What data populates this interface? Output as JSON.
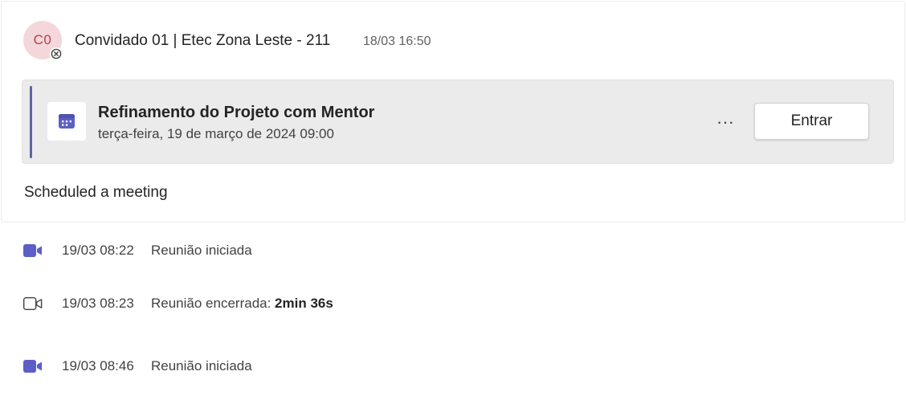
{
  "post": {
    "avatar_initials": "C0",
    "sender": "Convidado 01 | Etec Zona Leste - 211",
    "timestamp": "18/03 16:50",
    "presence_icon": "blocked-circle-icon",
    "meeting_card": {
      "icon": "calendar-icon",
      "title": "Refinamento do Projeto com Mentor",
      "datetime": "terça-feira, 19 de março de 2024 09:00",
      "more_label": "···",
      "join_label": "Entrar",
      "accent_color": "#6264a7"
    },
    "message": "Scheduled a meeting"
  },
  "events": [
    {
      "icon": "video-camera-filled-icon",
      "time": "19/03 08:22",
      "text": "Reunião iniciada",
      "duration": ""
    },
    {
      "icon": "video-camera-outline-icon",
      "time": "19/03 08:23",
      "text": "Reunião encerrada: ",
      "duration": "2min 36s"
    },
    {
      "icon": "video-camera-filled-icon",
      "time": "19/03 08:46",
      "text": "Reunião iniciada",
      "duration": ""
    }
  ]
}
